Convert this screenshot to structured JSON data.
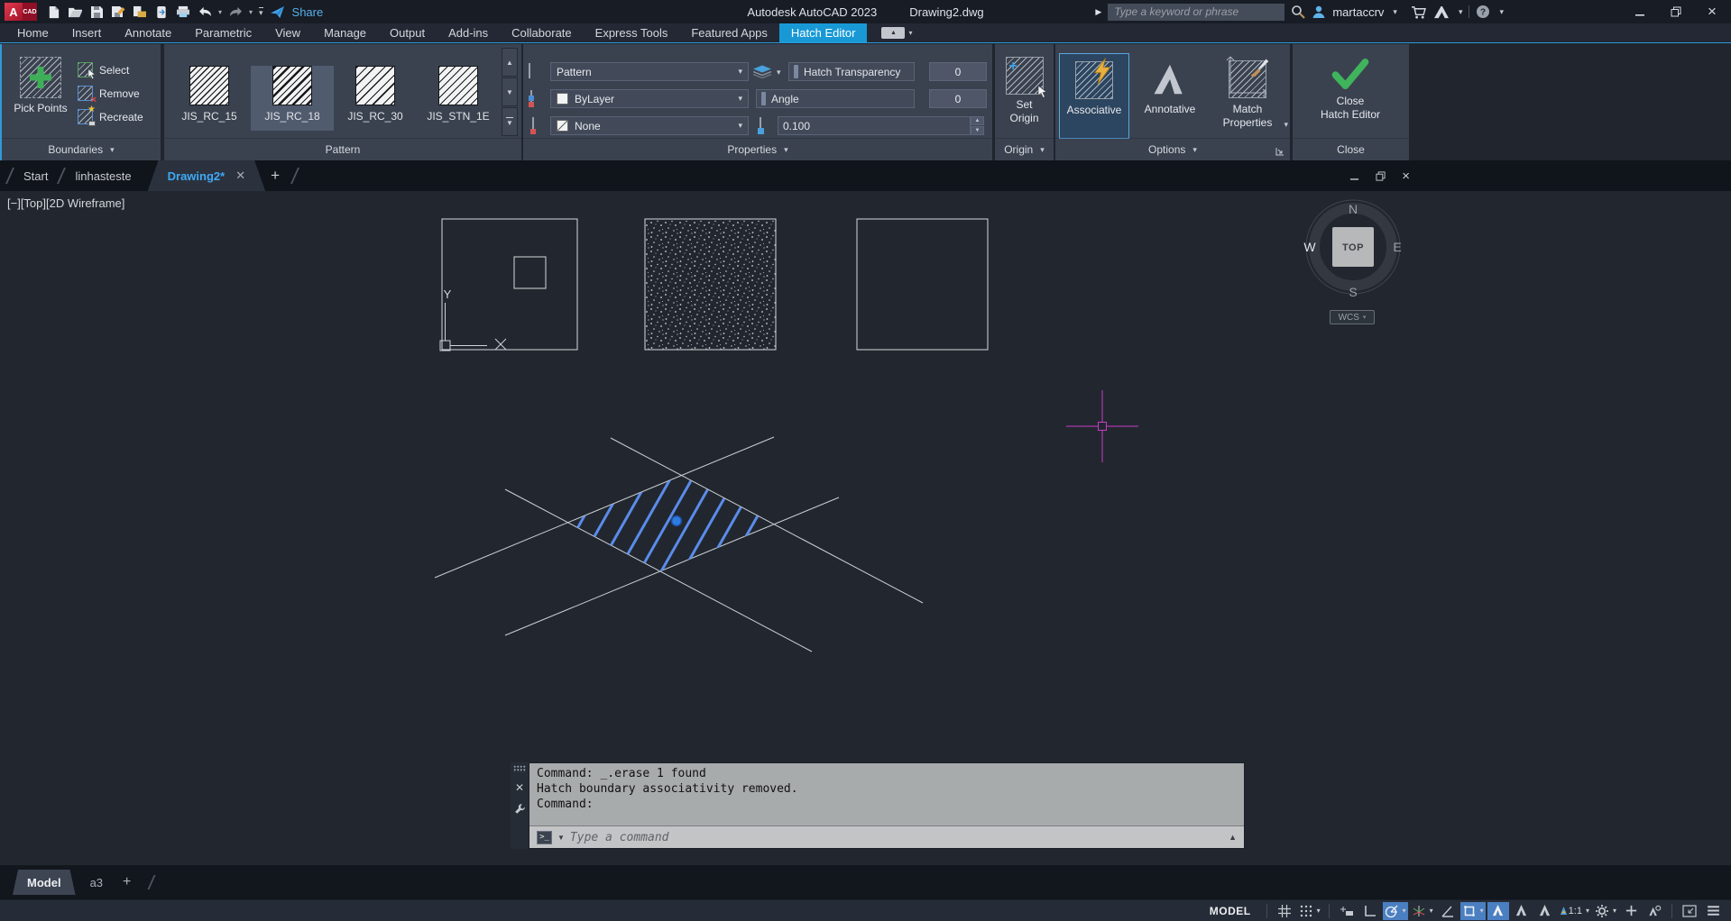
{
  "titlebar": {
    "app_title": "Autodesk AutoCAD 2023",
    "doc_title": "Drawing2.dwg",
    "share_label": "Share",
    "search_placeholder": "Type a keyword or phrase",
    "username": "martaccrv"
  },
  "ribbon_tabs": [
    {
      "label": "Home"
    },
    {
      "label": "Insert"
    },
    {
      "label": "Annotate"
    },
    {
      "label": "Parametric"
    },
    {
      "label": "View"
    },
    {
      "label": "Manage"
    },
    {
      "label": "Output"
    },
    {
      "label": "Add-ins"
    },
    {
      "label": "Collaborate"
    },
    {
      "label": "Express Tools"
    },
    {
      "label": "Featured Apps"
    },
    {
      "label": "Hatch Editor"
    }
  ],
  "panels": {
    "boundaries": {
      "label": "Boundaries",
      "pick_points": "Pick Points",
      "select": "Select",
      "remove": "Remove",
      "recreate": "Recreate"
    },
    "pattern": {
      "label": "Pattern",
      "swatches": [
        {
          "name": "JIS_RC_15"
        },
        {
          "name": "JIS_RC_18"
        },
        {
          "name": "JIS_RC_30"
        },
        {
          "name": "JIS_STN_1E"
        }
      ]
    },
    "properties": {
      "label": "Properties",
      "hatch_type": "Pattern",
      "color": "ByLayer",
      "background": "None",
      "transparency_label": "Hatch Transparency",
      "transparency_value": "0",
      "angle_label": "Angle",
      "angle_value": "0",
      "scale_value": "0.100"
    },
    "origin": {
      "label": "Origin",
      "button_line1": "Set",
      "button_line2": "Origin"
    },
    "options": {
      "label": "Options",
      "associative": "Associative",
      "annotative": "Annotative",
      "match_line1": "Match",
      "match_line2": "Properties"
    },
    "close": {
      "label": "Close",
      "button_line1": "Close",
      "button_line2": "Hatch Editor"
    }
  },
  "file_tabs": {
    "start": "Start",
    "doc1": "linhasteste",
    "doc2": "Drawing2*"
  },
  "viewport": {
    "label": "[−][Top][2D Wireframe]",
    "compass_n": "N",
    "compass_e": "E",
    "compass_s": "S",
    "compass_w": "W",
    "compass_center": "TOP",
    "wcs": "WCS",
    "axis_x": "X",
    "axis_y": "Y"
  },
  "command_window": {
    "history": [
      "Command: _.erase 1 found",
      "Hatch boundary associativity removed.",
      "Command:"
    ],
    "placeholder": "Type a command"
  },
  "layout_tabs": {
    "model": "Model",
    "a3": "a3"
  },
  "status_bar": {
    "space": "MODEL",
    "scale": "1:1"
  }
}
